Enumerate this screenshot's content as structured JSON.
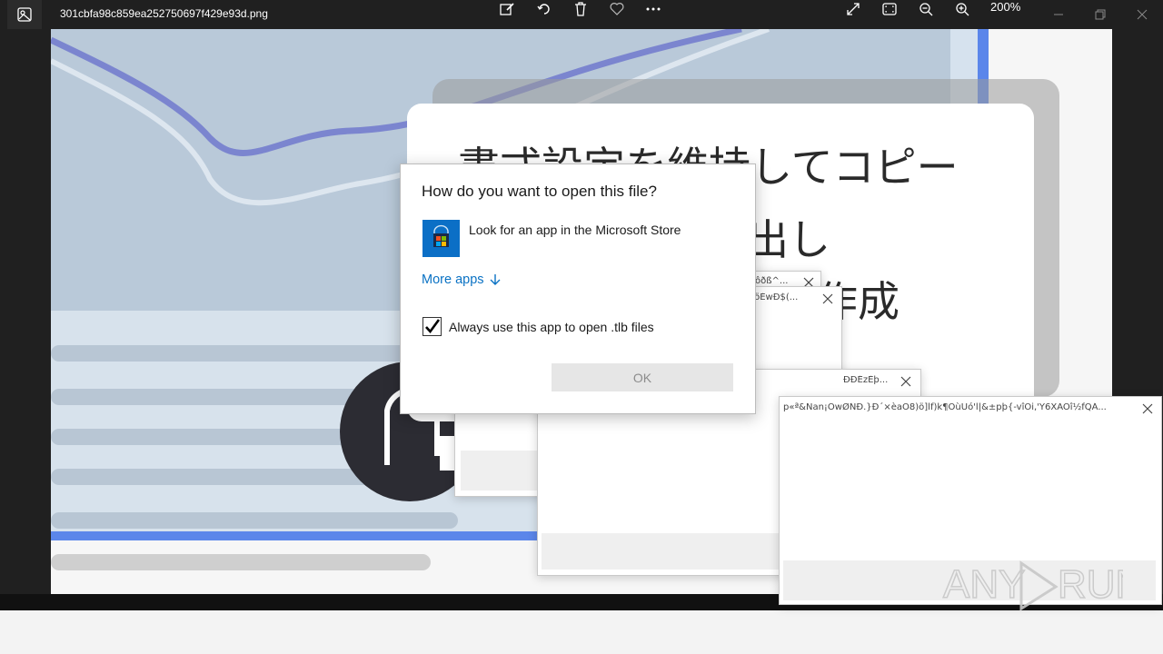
{
  "viewer": {
    "file_name": "301cbfa98c859ea252750697f429e93d.png",
    "zoom": "200%",
    "toolbar": [
      "edit-icon",
      "rotate-icon",
      "delete-icon",
      "favorite-icon",
      "more-icon"
    ],
    "view_controls": [
      "fullscreen-icon",
      "fit-icon",
      "zoom-out-icon",
      "zoom-in-icon"
    ]
  },
  "image": {
    "jp_line1": "書式設定を維持してコピー",
    "jp_line2": "を出し",
    "jp_line3": "作成"
  },
  "dialogs": {
    "garbled_1": "ôðß^...",
    "garbled_2": "'¶öÉwÐ$(...",
    "garbled_3": "ÐÐÉzÈþ...",
    "garbled_4": "p«ª&Nan¡ÕwØÑÐ.}Ð´×èaO8)ö]lf)k¶ÒùÛó'l|&±pþ{-vîÒi,'Y6XÄÕî½fQÁ..."
  },
  "main_dialog": {
    "title": "How do you want to open this file?",
    "store_option": "Look for an app in the Microsoft Store",
    "more_apps": "More apps",
    "always_label": "Always use this app to open .tlb files",
    "always_checked": true,
    "ok_label": "OK"
  },
  "watermark": {
    "left": "ANY",
    "right": "RUN"
  },
  "colors": {
    "accent_blue": "#0a72c4",
    "store_blue": "#0b6fc6",
    "titlebar": "#202020"
  }
}
